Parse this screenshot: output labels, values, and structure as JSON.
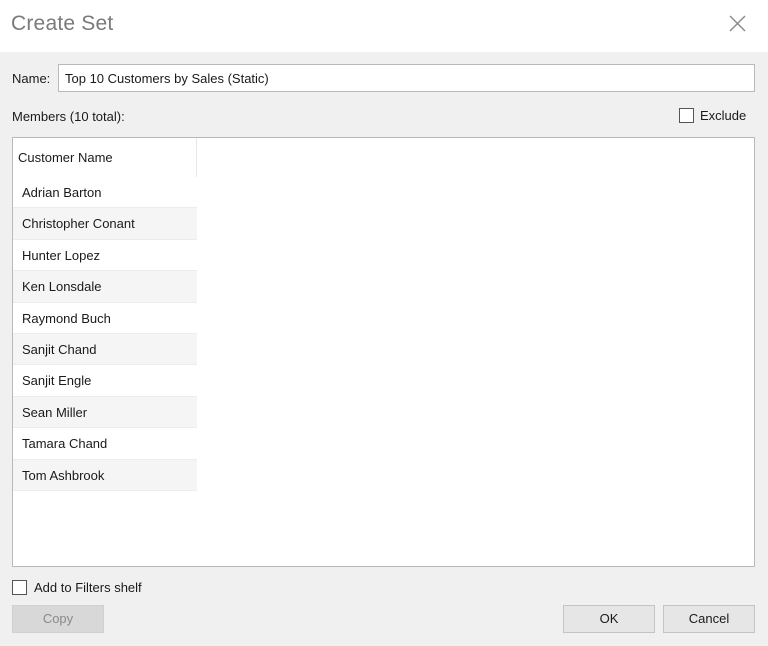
{
  "dialog": {
    "title": "Create Set"
  },
  "name_field": {
    "label": "Name:",
    "value": "Top 10 Customers by Sales (Static)"
  },
  "members": {
    "label": "Members (10 total):",
    "exclude_label": "Exclude",
    "exclude_checked": false,
    "column_header": "Customer Name",
    "items": [
      "Adrian Barton",
      "Christopher Conant",
      "Hunter Lopez",
      "Ken Lonsdale",
      "Raymond Buch",
      "Sanjit Chand",
      "Sanjit Engle",
      "Sean Miller",
      "Tamara Chand",
      "Tom Ashbrook"
    ]
  },
  "filters": {
    "label": "Add to Filters shelf",
    "checked": false
  },
  "buttons": {
    "copy": "Copy",
    "ok": "OK",
    "cancel": "Cancel"
  },
  "icons": {
    "close": "close-icon"
  }
}
